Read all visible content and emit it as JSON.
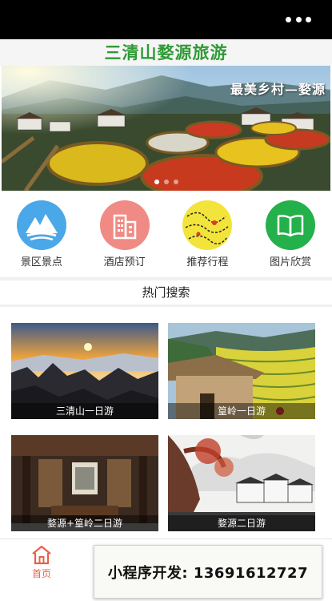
{
  "header": {
    "title": "三清山婺源旅游",
    "menu_icon": "more-dots-icon"
  },
  "banner": {
    "caption": "最美乡村—婺源",
    "slide_count": 3,
    "active_slide": 1
  },
  "nav": {
    "items": [
      {
        "label": "景区景点",
        "icon": "mountain-icon",
        "color": "#4aa8e8"
      },
      {
        "label": "酒店预订",
        "icon": "building-icon",
        "color": "#f08a84"
      },
      {
        "label": "推荐行程",
        "icon": "route-map-icon",
        "color": "#f2e43a"
      },
      {
        "label": "图片欣赏",
        "icon": "book-icon",
        "color": "#24b04a"
      }
    ]
  },
  "hot": {
    "title": "热门搜索",
    "cards": [
      {
        "caption": "三清山一日游"
      },
      {
        "caption": "篁岭一日游"
      },
      {
        "caption": "婺源+篁岭二日游"
      },
      {
        "caption": "婺源二日游"
      }
    ]
  },
  "tabbar": {
    "home_label": "首页",
    "home_icon": "home-icon",
    "accent": "#e8604c"
  },
  "promo": {
    "text": "小程序开发: 13691612727"
  }
}
